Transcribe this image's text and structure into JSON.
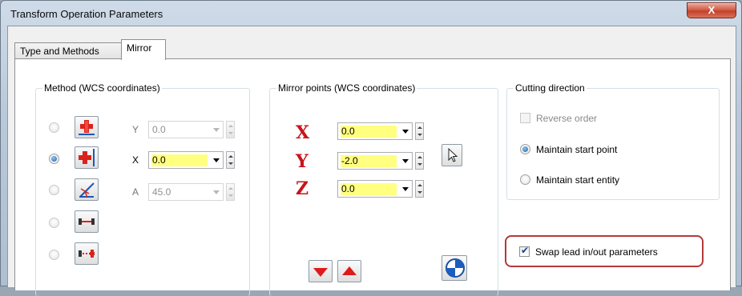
{
  "window": {
    "title": "Transform Operation Parameters",
    "close_glyph": "X"
  },
  "tabs": [
    {
      "label": "Type and Methods",
      "active": false
    },
    {
      "label": "Mirror",
      "active": true
    }
  ],
  "method": {
    "title": "Method (WCS coordinates)",
    "options": [
      {
        "icon": "mirror-about-x-axis-icon",
        "checked": false,
        "field_label": "Y",
        "value": "0.0",
        "enabled": false
      },
      {
        "icon": "mirror-about-y-axis-icon",
        "checked": true,
        "field_label": "X",
        "value": "0.0",
        "enabled": true
      },
      {
        "icon": "mirror-about-angle-icon",
        "checked": false,
        "field_label": "A",
        "value": "45.0",
        "enabled": false
      },
      {
        "icon": "mirror-about-line-icon",
        "checked": false
      },
      {
        "icon": "mirror-about-two-points-icon",
        "checked": false
      }
    ]
  },
  "mirror_points": {
    "title": "Mirror points (WCS coordinates)",
    "x": {
      "label": "X",
      "value": "0.0"
    },
    "y": {
      "label": "Y",
      "value": "-2.0"
    },
    "z": {
      "label": "Z",
      "value": "0.0"
    }
  },
  "cutting_direction": {
    "title": "Cutting direction",
    "reverse_order": {
      "label": "Reverse order",
      "checked": false,
      "enabled": false
    },
    "maintain_start_point": {
      "label": "Maintain start point",
      "checked": true
    },
    "maintain_start_entity": {
      "label": "Maintain start entity",
      "checked": false
    }
  },
  "swap_lead": {
    "label": "Swap lead in/out parameters",
    "checked": true
  },
  "colors": {
    "field_highlight": "#ffff80",
    "axis_letter": "#c8141a",
    "highlight_ring": "#b33a3a"
  }
}
